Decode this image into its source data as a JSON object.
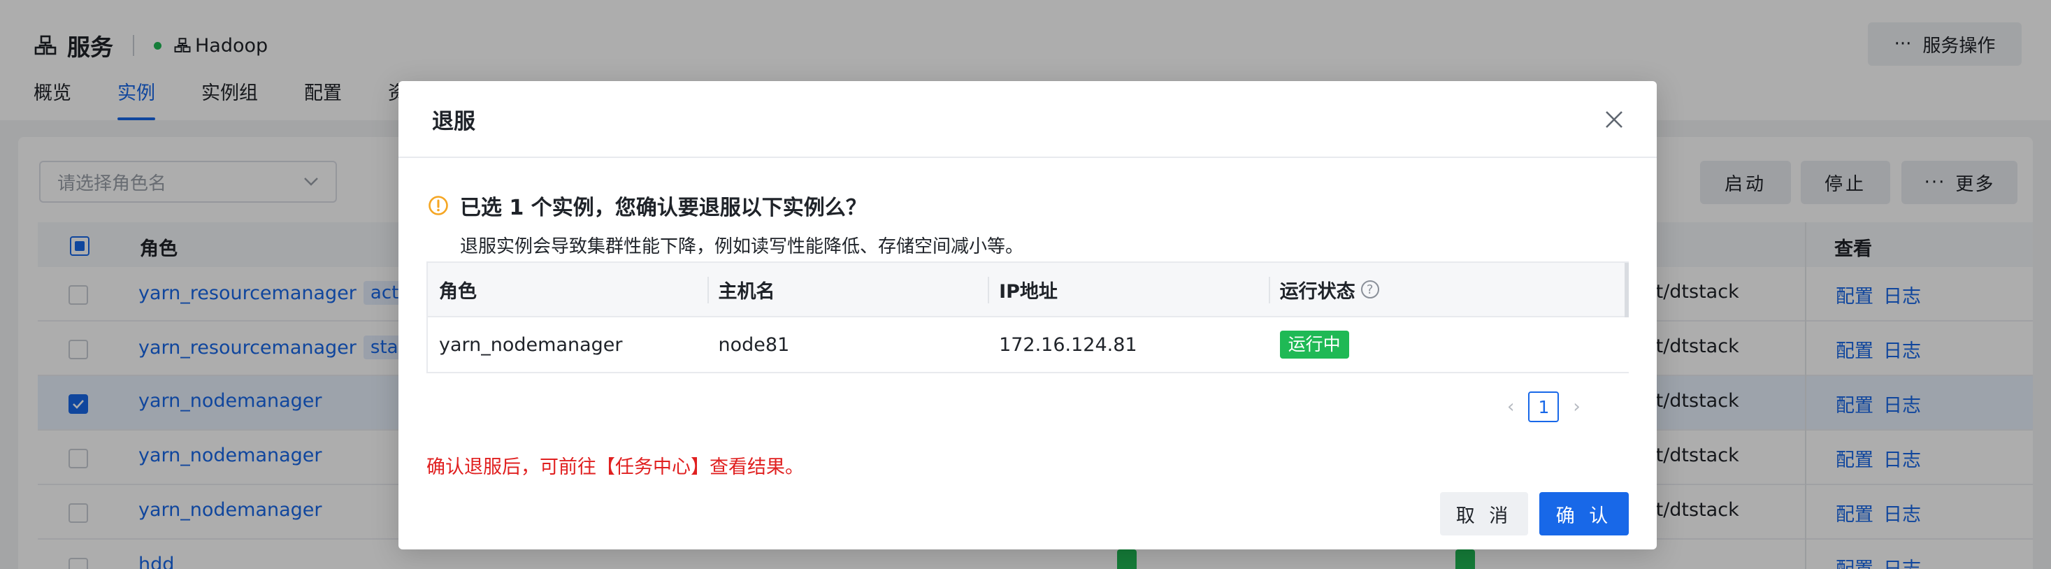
{
  "header": {
    "service_label": "服务",
    "cluster_label": "Hadoop",
    "ops_label": "服务操作"
  },
  "tabs": [
    {
      "label": "概览"
    },
    {
      "label": "实例"
    },
    {
      "label": "实例组"
    },
    {
      "label": "配置"
    },
    {
      "label": "资"
    }
  ],
  "toolbar": {
    "role_select_placeholder": "请选择角色名",
    "start_label": "启动",
    "stop_label": "停止",
    "more_label": "更多"
  },
  "table": {
    "col_role": "角色",
    "col_view": "查看",
    "rows": [
      {
        "role": "yarn_resourcemanager",
        "tag": "active",
        "path": "ult/dtstack",
        "links": [
          "配置",
          "日志"
        ],
        "selected": false
      },
      {
        "role": "yarn_resourcemanager",
        "tag": "standb",
        "path": "ult/dtstack",
        "links": [
          "配置",
          "日志"
        ],
        "selected": false
      },
      {
        "role": "yarn_nodemanager",
        "tag": "",
        "path": "ult/dtstack",
        "links": [
          "配置",
          "日志"
        ],
        "selected": true
      },
      {
        "role": "yarn_nodemanager",
        "tag": "",
        "path": "ult/dtstack",
        "links": [
          "配置",
          "日志"
        ],
        "selected": false
      },
      {
        "role": "yarn_nodemanager",
        "tag": "",
        "path": "ult/dtstack",
        "links": [
          "配置",
          "日志"
        ],
        "selected": false
      },
      {
        "role": "hdd",
        "tag": "",
        "path": "",
        "links": [
          "配置",
          "日志"
        ],
        "selected": false
      }
    ]
  },
  "modal": {
    "title": "退服",
    "question": "已选 1 个实例，您确认要退服以下实例么？",
    "description": "退服实例会导致集群性能下降，例如读写性能降低、存储空间减小等。",
    "columns": [
      "角色",
      "主机名",
      "IP地址",
      "运行状态"
    ],
    "rows": [
      {
        "role": "yarn_nodemanager",
        "host": "node81",
        "ip": "172.16.124.81",
        "status": "运行中"
      }
    ],
    "current_page": "1",
    "warning": "确认退服后，可前往【任务中心】查看结果。",
    "cancel_label": "取 消",
    "ok_label": "确 认"
  },
  "colors": {
    "primary": "#1868e8",
    "success": "#1fb955",
    "danger": "#e02020",
    "warning_icon": "#f5a623"
  }
}
